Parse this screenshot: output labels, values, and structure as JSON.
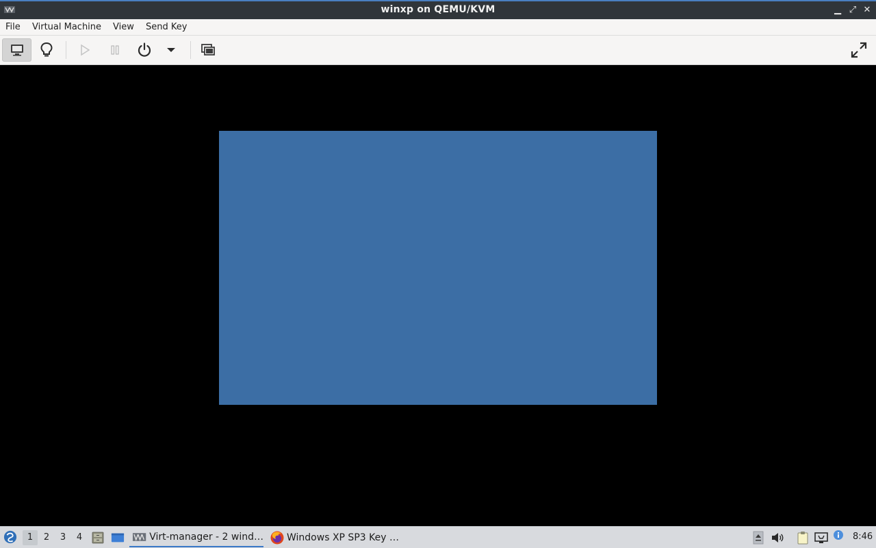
{
  "window": {
    "title": "winxp on QEMU/KVM",
    "controls": {
      "minimize": "▁",
      "maximize": "⤢",
      "close": "✕"
    }
  },
  "menu": {
    "items": [
      "File",
      "Virtual Machine",
      "View",
      "Send Key"
    ]
  },
  "toolbar": {
    "buttons": [
      {
        "icon": "console-monitor-icon",
        "state": "selected"
      },
      {
        "icon": "details-lightbulb-icon"
      },
      {
        "icon": "run-play-icon",
        "state": "disabled"
      },
      {
        "icon": "pause-icon",
        "state": "disabled"
      },
      {
        "icon": "power-icon"
      },
      {
        "icon": "dropdown-arrow-icon"
      },
      {
        "icon": "snapshots-icon"
      },
      {
        "icon": "fullscreen-icon"
      }
    ]
  },
  "guest": {
    "background_color": "#3c6ea5"
  },
  "panel": {
    "workspaces": [
      "1",
      "2",
      "3",
      "4"
    ],
    "active_workspace": "1",
    "tasks": [
      {
        "label": "Virt-manager - 2 wind…",
        "icon": "virt-manager-icon",
        "active": true
      },
      {
        "label": "Windows XP SP3 Key …",
        "icon": "firefox-icon",
        "active": false
      }
    ],
    "clock": "8:46"
  },
  "colors": {
    "titlebar": "#30353a",
    "accent": "#4a7fc1",
    "toolbar_bg": "#f6f5f4",
    "panel_bg": "#d8dade",
    "guest_screen": "#3c6ea5"
  }
}
